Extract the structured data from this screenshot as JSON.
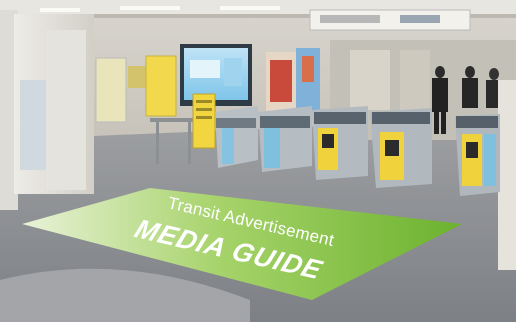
{
  "floor_mat": {
    "subtitle": "Transit Advertisement",
    "title": "MEDIA GUIDE",
    "color_light": "#e8f2d6",
    "color_dark": "#6eb32f"
  }
}
